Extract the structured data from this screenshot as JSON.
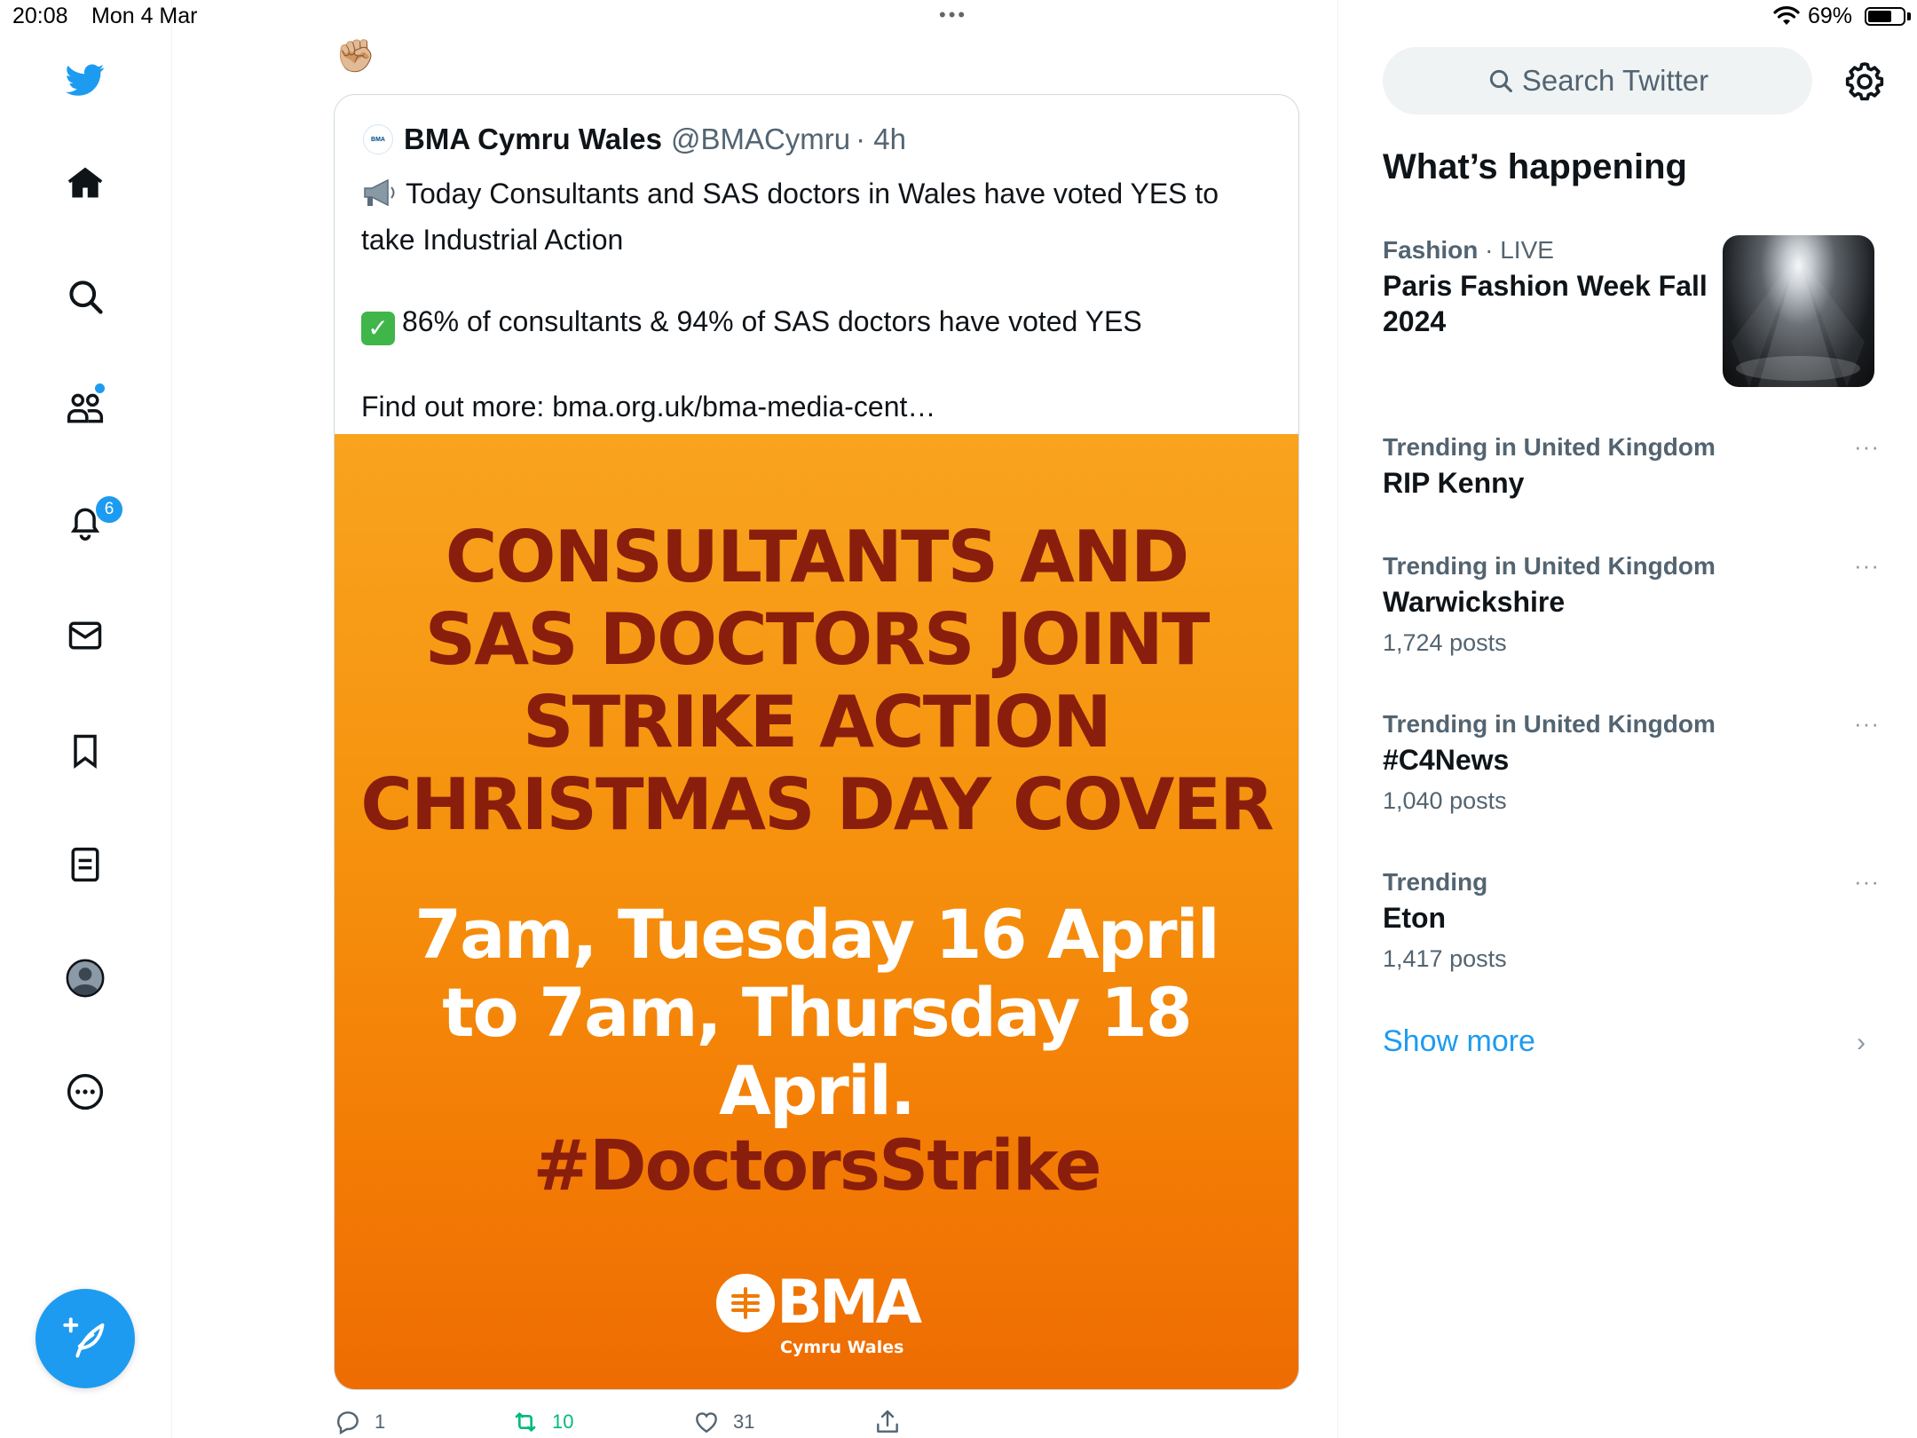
{
  "status_bar": {
    "time": "20:08",
    "date": "Mon 4 Mar",
    "multitask_dots": "•••",
    "battery_percent": "69%",
    "battery_level": 0.69
  },
  "nav": {
    "items": [
      {
        "name": "twitter-logo-icon"
      },
      {
        "name": "home-icon"
      },
      {
        "name": "search-icon"
      },
      {
        "name": "communities-icon"
      },
      {
        "name": "notifications-icon"
      },
      {
        "name": "messages-icon"
      },
      {
        "name": "bookmarks-icon"
      },
      {
        "name": "lists-icon"
      },
      {
        "name": "profile-icon"
      },
      {
        "name": "more-icon"
      }
    ],
    "notifications_badge": "6",
    "compose_icon": "feather-plus-icon"
  },
  "tweet": {
    "leading_emoji": "✊🏼",
    "quote": {
      "account_name": "BMA Cymru Wales",
      "handle": "@BMACymru",
      "time": "· 4h",
      "avatar_text": "BMA",
      "line1": "Today Consultants and SAS doctors in Wales have voted YES to take Industrial Action",
      "line2": "86% of consultants & 94% of SAS doctors have voted YES",
      "line3": "Find out more: bma.org.uk/bma-media-cent…",
      "image": {
        "headline_lines": [
          "CONSULTANTS AND",
          "SAS DOCTORS JOINT",
          "STRIKE ACTION",
          "CHRISTMAS DAY COVER"
        ],
        "date_lines": [
          "7am, Tuesday 16 April",
          "to 7am, Thursday 18 April."
        ],
        "hashtag": "#DoctorsStrike",
        "logo_word": "BMA",
        "logo_sub": "Cymru Wales",
        "background_color": "#f6930e",
        "headline_color": "#8a1e0c"
      }
    },
    "actions": {
      "replies": "1",
      "retweets": "10",
      "likes": "31",
      "retweet_color": "#00ba7c"
    }
  },
  "sidebar": {
    "search_placeholder": "Search Twitter",
    "section_title": "What’s happening",
    "trends": [
      {
        "category": "Fashion",
        "meta": " · LIVE",
        "name": "Paris Fashion Week Fall 2024",
        "posts": ""
      },
      {
        "category": "Trending in United Kingdom",
        "meta": "",
        "name": "RIP Kenny",
        "posts": ""
      },
      {
        "category": "Trending in United Kingdom",
        "meta": "",
        "name": "Warwickshire",
        "posts": "1,724 posts"
      },
      {
        "category": "Trending in United Kingdom",
        "meta": "",
        "name": "#C4News",
        "posts": "1,040 posts"
      },
      {
        "category": "Trending",
        "meta": "",
        "name": "Eton",
        "posts": "1,417 posts"
      }
    ],
    "more_glyph": "···",
    "show_more": "Show more",
    "show_more_chevron": "›"
  },
  "accent_color": "#1d9bf0"
}
